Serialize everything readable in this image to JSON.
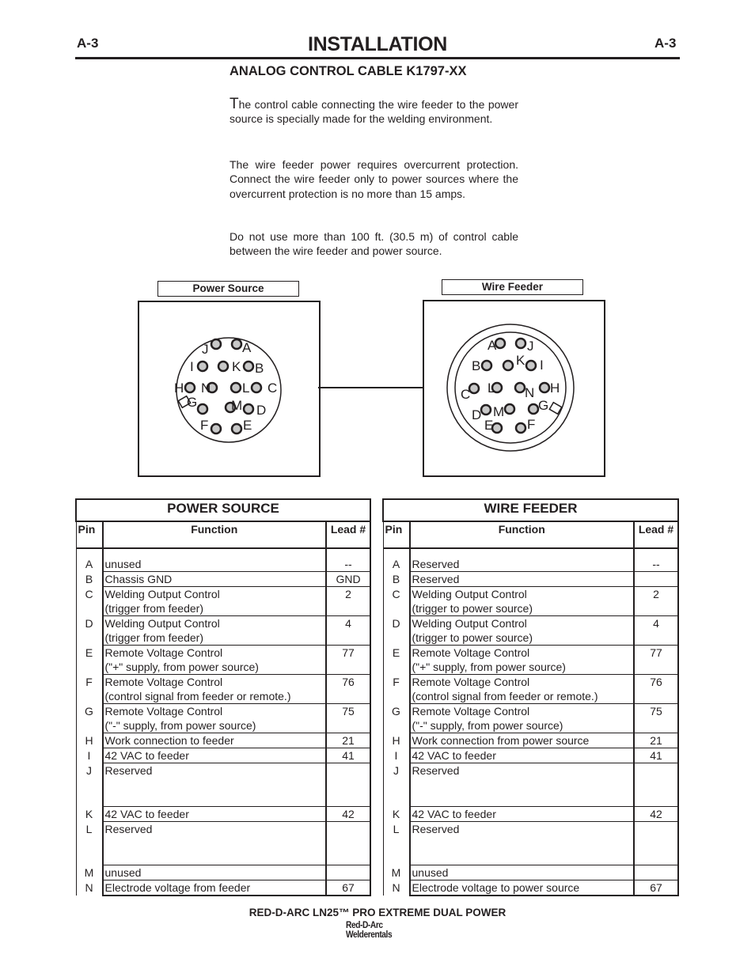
{
  "header": {
    "page_code_left": "A-3",
    "page_code_right": "A-3",
    "title": "INSTALLATION"
  },
  "section": {
    "title": "ANALOG CONTROL CABLE K1797-XX",
    "paragraphs": {
      "p1_dropcap": "T",
      "p1_rest": "he control cable connecting the wire feeder to the power source is specially made for the welding environment.",
      "p2": "The wire feeder power requires overcurrent protection.  Connect the wire feeder only to power sources where the overcurrent protection is no more than 15 amps.",
      "p3": "Do not use more than 100 ft. (30.5 m) of control cable between the wire feeder and power source."
    }
  },
  "diagram": {
    "power_source_label": "Power Source",
    "wire_feeder_label": "Wire Feeder",
    "pin_fill": "#c8c8c8",
    "line_color": "#231f20",
    "power_source_pins": [
      "A",
      "B",
      "C",
      "D",
      "E",
      "F",
      "G",
      "H",
      "I",
      "J",
      "K",
      "L",
      "M",
      "N"
    ],
    "wire_feeder_pins": [
      "A",
      "B",
      "C",
      "D",
      "E",
      "F",
      "G",
      "H",
      "I",
      "J",
      "K",
      "L",
      "M",
      "N"
    ]
  },
  "power_source_table": {
    "title": "POWER SOURCE",
    "headers": {
      "pin": "Pin",
      "function": "Function",
      "lead": "Lead #"
    },
    "rows": [
      {
        "pin": "A",
        "function": "unused",
        "lead": "--"
      },
      {
        "pin": "B",
        "function": "Chassis GND",
        "lead": "GND"
      },
      {
        "pin": "C",
        "function": "Welding Output Control",
        "function2": "(trigger from feeder)",
        "lead": "2"
      },
      {
        "pin": "D",
        "function": "Welding Output Control",
        "function2": "(trigger from feeder)",
        "lead": "4"
      },
      {
        "pin": "E",
        "function": "Remote Voltage Control",
        "function2": "(\"+\" supply, from power source)",
        "lead": "77"
      },
      {
        "pin": "F",
        "function": "Remote Voltage Control",
        "function2": "(control signal from feeder or remote.)",
        "lead": "76"
      },
      {
        "pin": "G",
        "function": "Remote Voltage Control",
        "function2": "(\"-\" supply, from power source)",
        "lead": "75"
      },
      {
        "pin": "H",
        "function": "Work connection to feeder",
        "lead": "21"
      },
      {
        "pin": "I",
        "function": "42 VAC to feeder",
        "lead": "41"
      },
      {
        "pin": "J",
        "function": "Reserved",
        "lead": ""
      },
      {
        "pin": "K",
        "function": "42 VAC to feeder",
        "lead": "42"
      },
      {
        "pin": "L",
        "function": "Reserved",
        "lead": ""
      },
      {
        "pin": "M",
        "function": "unused",
        "lead": ""
      },
      {
        "pin": "N",
        "function": "Electrode voltage from feeder",
        "lead": "67"
      }
    ]
  },
  "wire_feeder_table": {
    "title": "WIRE FEEDER",
    "headers": {
      "pin": "Pin",
      "function": "Function",
      "lead": "Lead #"
    },
    "rows": [
      {
        "pin": "A",
        "function": "Reserved",
        "lead": "--"
      },
      {
        "pin": "B",
        "function": "Reserved",
        "lead": ""
      },
      {
        "pin": "C",
        "function": "Welding Output Control",
        "function2": "(trigger to power source)",
        "lead": "2"
      },
      {
        "pin": "D",
        "function": "Welding Output Control",
        "function2": "(trigger to power source)",
        "lead": "4"
      },
      {
        "pin": "E",
        "function": "Remote Voltage Control",
        "function2": "(\"+\" supply, from power source)",
        "lead": "77"
      },
      {
        "pin": "F",
        "function": "Remote Voltage Control",
        "function2": "(control signal from feeder or remote.)",
        "lead": "76"
      },
      {
        "pin": "G",
        "function": "Remote Voltage Control",
        "function2": "(\"-\" supply, from power source)",
        "lead": "75"
      },
      {
        "pin": "H",
        "function": "Work connection from power source",
        "lead": "21"
      },
      {
        "pin": "I",
        "function": "42 VAC to feeder",
        "lead": "41"
      },
      {
        "pin": "J",
        "function": "Reserved",
        "lead": ""
      },
      {
        "pin": "K",
        "function": "42 VAC to feeder",
        "lead": "42"
      },
      {
        "pin": "L",
        "function": "Reserved",
        "lead": ""
      },
      {
        "pin": "M",
        "function": "unused",
        "lead": ""
      },
      {
        "pin": "N",
        "function": "Electrode voltage to power source",
        "lead": "67"
      }
    ]
  },
  "footer": {
    "product": "RED-D-ARC LN25™ PRO EXTREME DUAL POWER",
    "brand_line1": "Red-D-Arc",
    "brand_line2": "Welderentals"
  }
}
